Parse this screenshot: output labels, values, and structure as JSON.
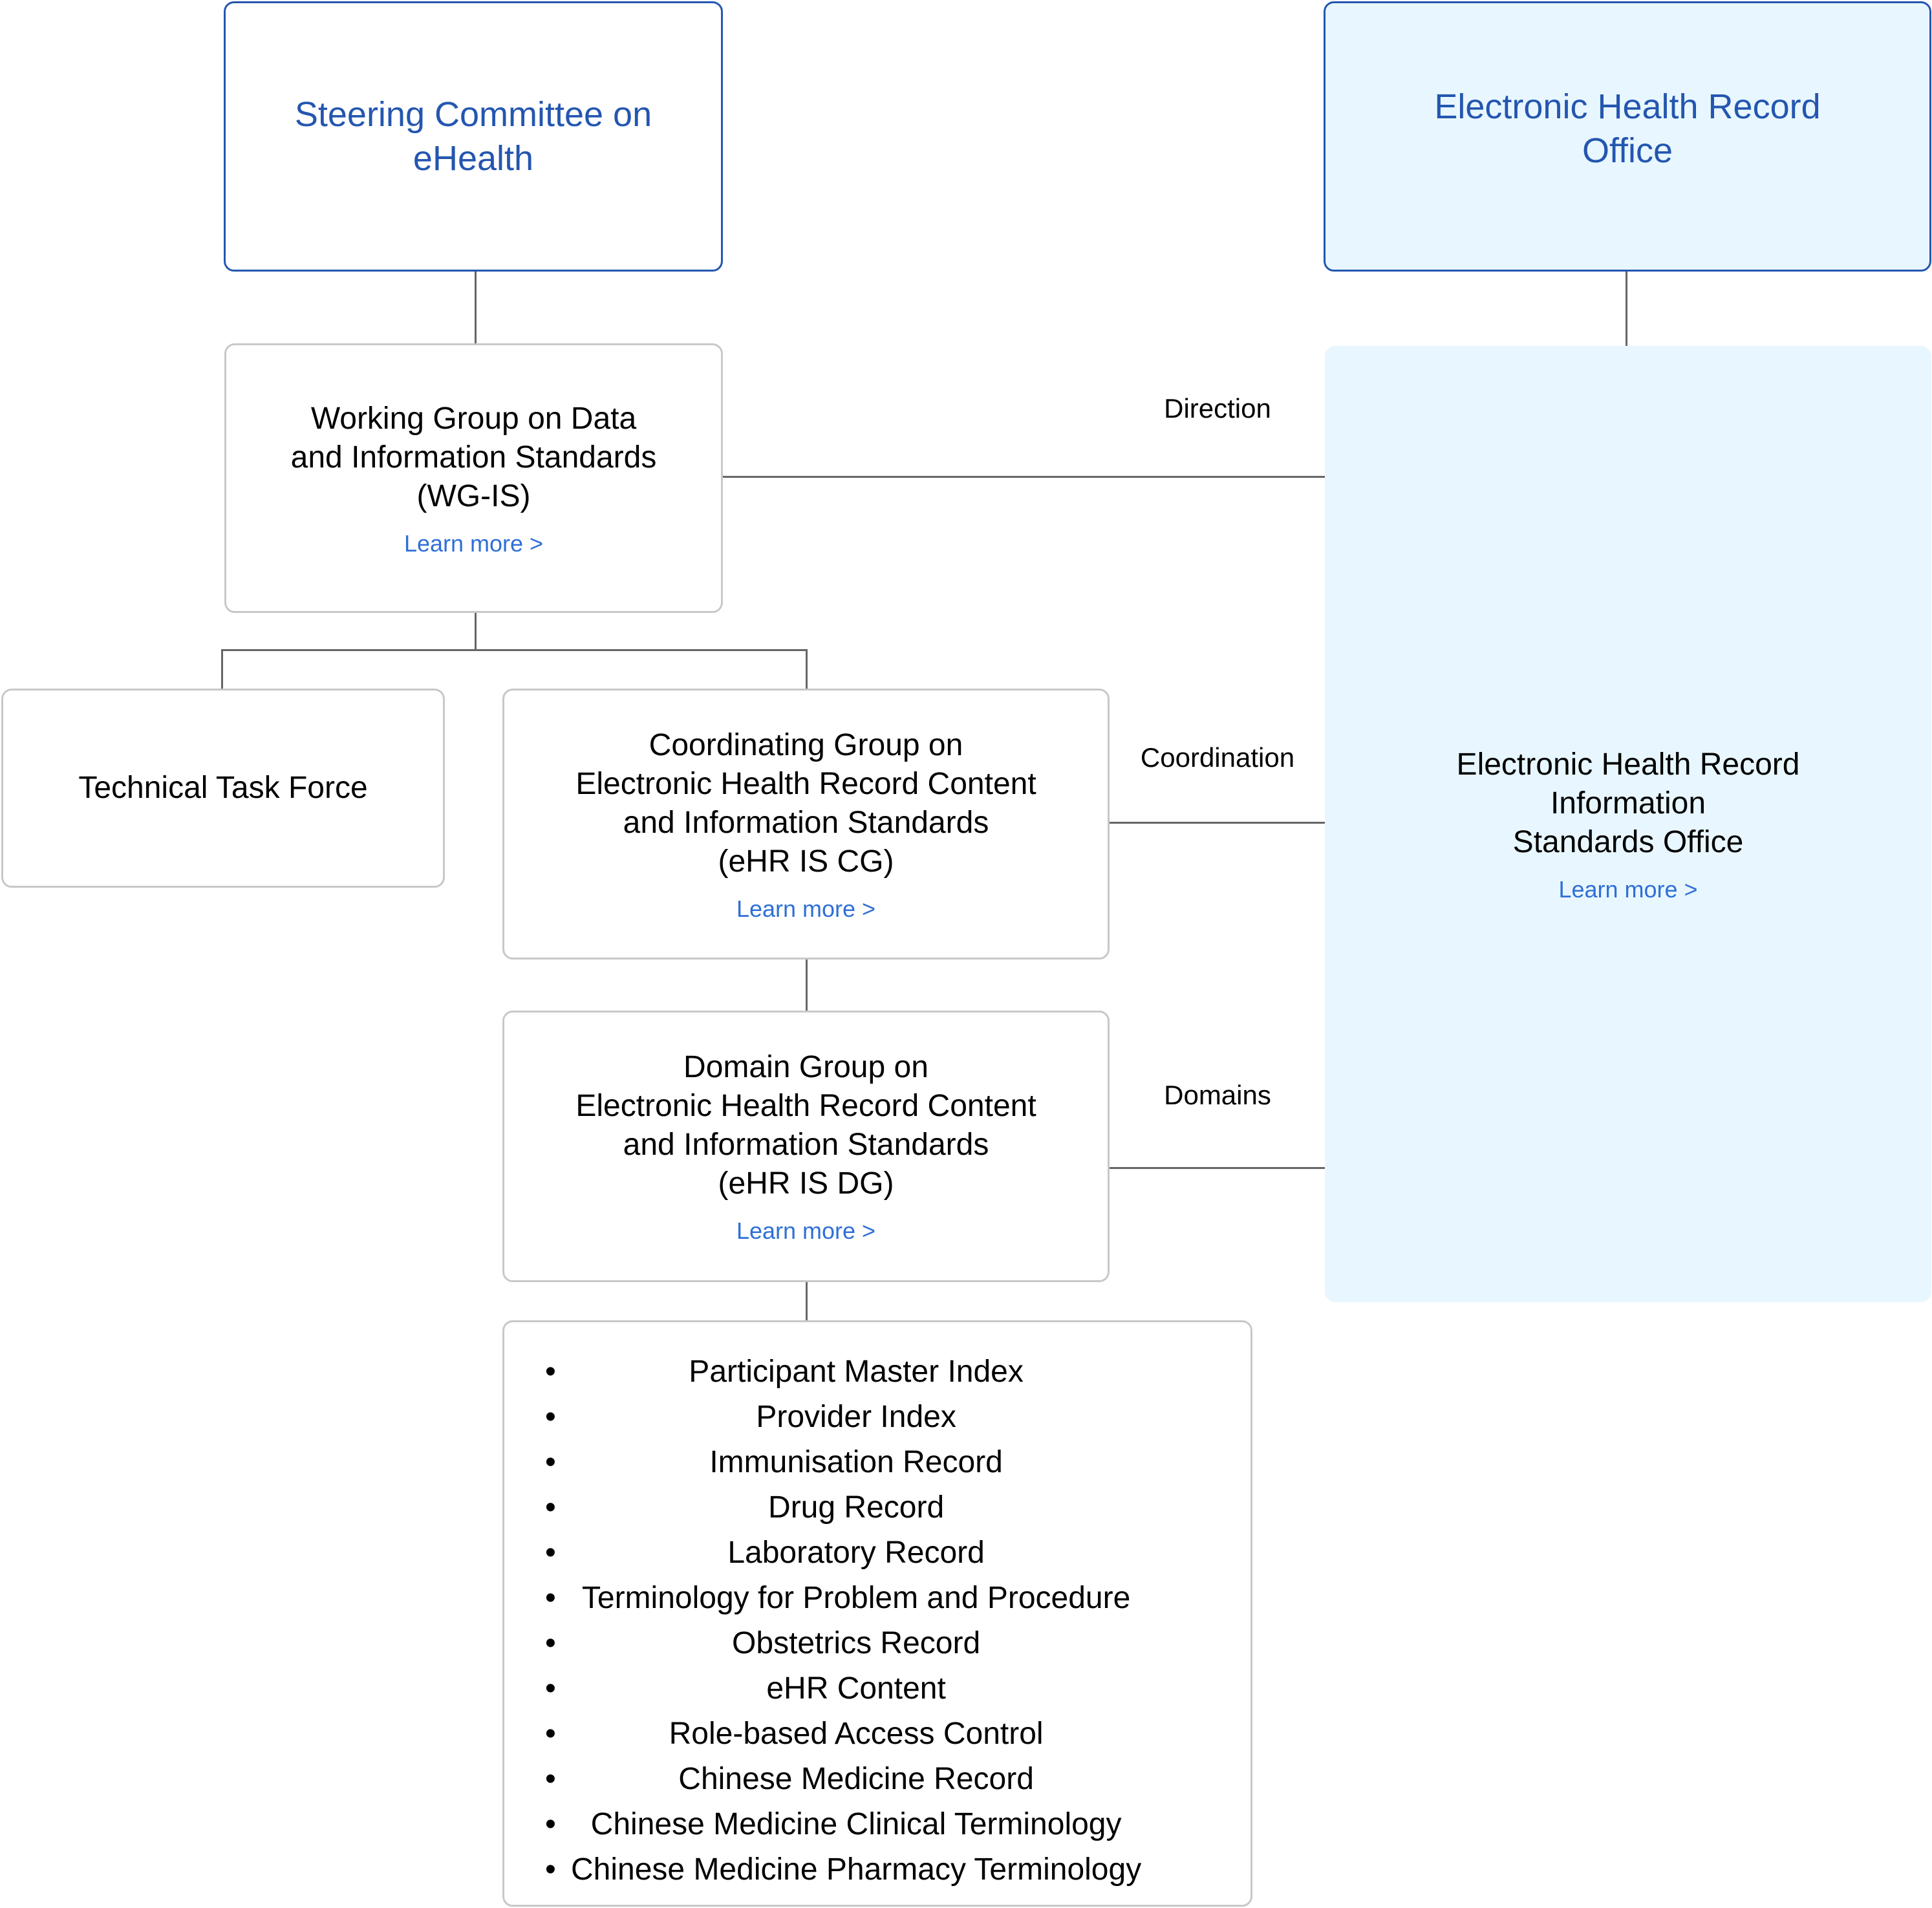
{
  "colors": {
    "accent_blue": "#2456b0",
    "link_blue": "#2f6fd6",
    "light_bg": "#e8f7ff",
    "box_border": "#c8c8c8",
    "connector": "#666666"
  },
  "steering_committee": {
    "lines": [
      "Steering Committee on",
      "eHealth"
    ]
  },
  "ehr_office": {
    "lines": [
      "Electronic Health Record",
      "Office"
    ]
  },
  "wg_is": {
    "lines": [
      "Working Group on Data",
      "and Information Standards",
      "(WG-IS)"
    ],
    "link": "Learn more >"
  },
  "technical_task_force": {
    "lines": [
      "Technical Task Force"
    ]
  },
  "coordinating_group": {
    "lines": [
      "Coordinating Group on",
      "Electronic Health Record Content",
      "and Information Standards",
      "(eHR IS CG)"
    ],
    "link": "Learn more >"
  },
  "domain_group": {
    "lines": [
      "Domain Group on",
      "Electronic Health Record Content",
      "and Information Standards",
      "(eHR IS DG)"
    ],
    "link": "Learn more >"
  },
  "ehr_is_office": {
    "lines": [
      "Electronic Health Record",
      "Information",
      "Standards Office"
    ],
    "link": "Learn more >"
  },
  "relations": {
    "direction": "Direction",
    "coordination": "Coordination",
    "domains": "Domains"
  },
  "domains_list": {
    "bullet": "•",
    "items": [
      "Participant Master Index",
      "Provider Index",
      "Immunisation Record",
      "Drug Record",
      "Laboratory Record",
      "Terminology for Problem and Procedure",
      "Obstetrics Record",
      "eHR Content",
      "Role-based Access Control",
      "Chinese Medicine Record",
      "Chinese Medicine Clinical Terminology",
      "Chinese Medicine Pharmacy Terminology"
    ]
  }
}
